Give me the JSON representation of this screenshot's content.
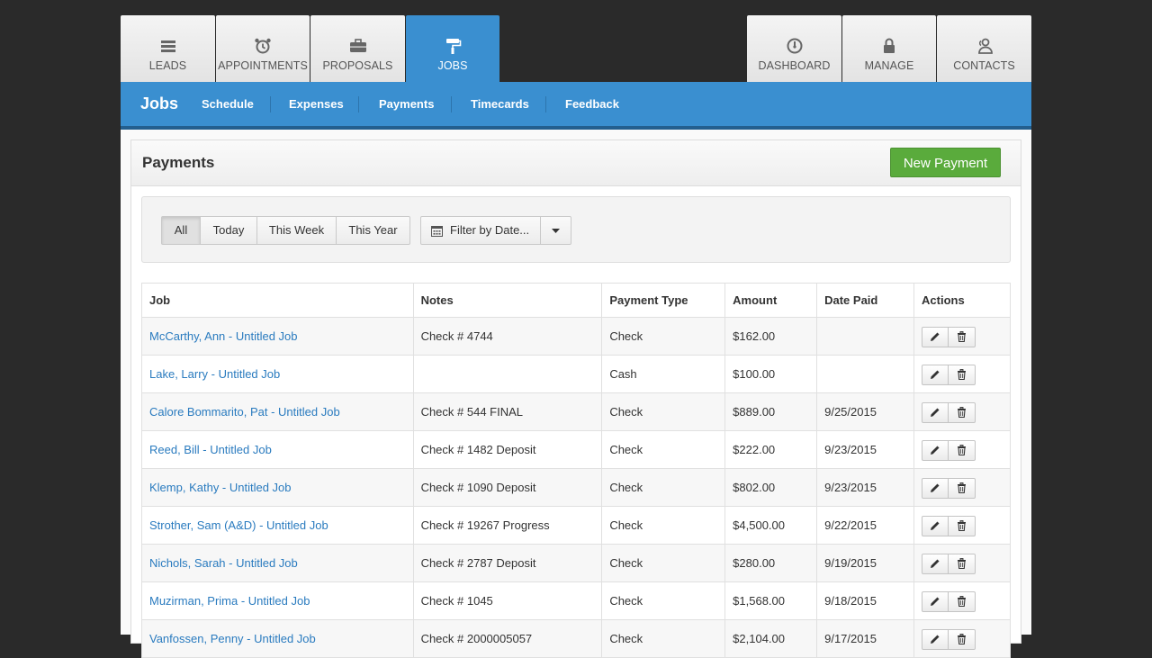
{
  "tabs": [
    {
      "label": "LEADS",
      "icon": "stack-icon"
    },
    {
      "label": "APPOINTMENTS",
      "icon": "alarm-clock-icon"
    },
    {
      "label": "PROPOSALS",
      "icon": "briefcase-icon"
    },
    {
      "label": "JOBS",
      "icon": "paint-roller-icon",
      "active": true
    },
    {
      "label": "DASHBOARD",
      "icon": "gauge-icon"
    },
    {
      "label": "MANAGE",
      "icon": "lock-icon"
    },
    {
      "label": "CONTACTS",
      "icon": "users-icon"
    }
  ],
  "subnav": {
    "brand": "Jobs",
    "items": [
      "Schedule",
      "Expenses",
      "Payments",
      "Timecards",
      "Feedback"
    ]
  },
  "panel": {
    "title": "Payments",
    "new_button": "New Payment"
  },
  "filters": {
    "segments": [
      "All",
      "Today",
      "This Week",
      "This Year"
    ],
    "active": "All",
    "date_filter": "Filter by Date..."
  },
  "table": {
    "columns": [
      "Job",
      "Notes",
      "Payment Type",
      "Amount",
      "Date Paid",
      "Actions"
    ],
    "rows": [
      {
        "job": "McCarthy, Ann - Untitled Job",
        "notes": "Check # 4744",
        "type": "Check",
        "amount": "$162.00",
        "date": ""
      },
      {
        "job": "Lake, Larry - Untitled Job",
        "notes": "",
        "type": "Cash",
        "amount": "$100.00",
        "date": ""
      },
      {
        "job": "Calore Bommarito, Pat - Untitled Job",
        "notes": "Check # 544 FINAL",
        "type": "Check",
        "amount": "$889.00",
        "date": "9/25/2015"
      },
      {
        "job": "Reed, Bill - Untitled Job",
        "notes": "Check # 1482 Deposit",
        "type": "Check",
        "amount": "$222.00",
        "date": "9/23/2015"
      },
      {
        "job": "Klemp, Kathy - Untitled Job",
        "notes": "Check # 1090 Deposit",
        "type": "Check",
        "amount": "$802.00",
        "date": "9/23/2015"
      },
      {
        "job": "Strother, Sam (A&D) - Untitled Job",
        "notes": "Check # 19267 Progress",
        "type": "Check",
        "amount": "$4,500.00",
        "date": "9/22/2015"
      },
      {
        "job": "Nichols, Sarah - Untitled Job",
        "notes": "Check # 2787 Deposit",
        "type": "Check",
        "amount": "$280.00",
        "date": "9/19/2015"
      },
      {
        "job": "Muzirman, Prima - Untitled Job",
        "notes": "Check # 1045",
        "type": "Check",
        "amount": "$1,568.00",
        "date": "9/18/2015"
      },
      {
        "job": "Vanfossen, Penny - Untitled Job",
        "notes": "Check # 2000005057",
        "type": "Check",
        "amount": "$2,104.00",
        "date": "9/17/2015"
      }
    ]
  },
  "colors": {
    "accent": "#3a8fd0",
    "success": "#5aab3c",
    "link": "#2a7bbf"
  }
}
